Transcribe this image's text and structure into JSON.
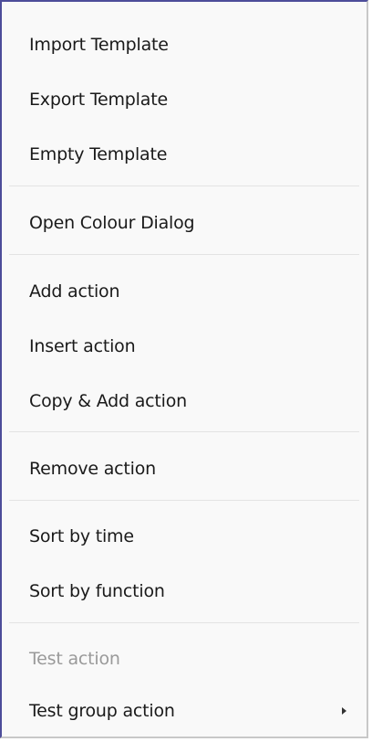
{
  "menu": {
    "import_template": "Import Template",
    "export_template": "Export Template",
    "empty_template": "Empty Template",
    "open_colour_dialog": "Open Colour Dialog",
    "add_action": "Add action",
    "insert_action": "Insert action",
    "copy_add_action": "Copy & Add action",
    "remove_action": "Remove action",
    "sort_by_time": "Sort by time",
    "sort_by_function": "Sort by function",
    "test_action": "Test action",
    "test_group_action": "Test group action"
  },
  "icons": {
    "submenu": "chevron-right-icon"
  },
  "colors": {
    "menu_background": "#f9f9f9",
    "text": "#1a1a1a",
    "disabled_text": "#9a9a9a",
    "separator": "#e3e3e3",
    "focus_border": "#4d4d9a"
  },
  "state": {
    "test_action_enabled": false
  }
}
